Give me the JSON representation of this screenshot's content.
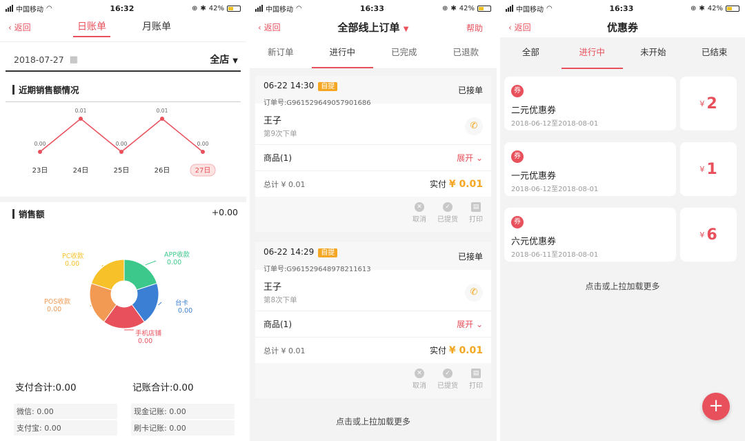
{
  "colors": {
    "accent": "#e8505b",
    "tag": "#f5a623",
    "pay": "#f5a623"
  },
  "statusbar": {
    "carrier": "中国移动",
    "battery": "42%"
  },
  "screen1": {
    "time": "16:32",
    "back": "返回",
    "tabs": [
      "日账单",
      "月账单"
    ],
    "active_tab": 0,
    "date": "2018-07-27",
    "store": "全店",
    "trend_title": "近期销售额情况",
    "trend": {
      "labels": [
        "23日",
        "24日",
        "25日",
        "26日",
        "27日"
      ],
      "values": [
        "0.00",
        "0.01",
        "0.00",
        "0.01",
        "0.00"
      ],
      "numeric": [
        0.0,
        0.01,
        0.0,
        0.01,
        0.0
      ]
    },
    "sales_title": "销售额",
    "sales_value": "+0.00",
    "donut": {
      "segments": [
        {
          "name": "APP收款",
          "value": "0.00",
          "color": "#3dc88b",
          "share": 0.2
        },
        {
          "name": "台卡",
          "value": "0.00",
          "color": "#3b7fd4",
          "share": 0.2
        },
        {
          "name": "手机店铺",
          "value": "0.00",
          "color": "#e8505b",
          "share": 0.2
        },
        {
          "name": "POS收款",
          "value": "0.00",
          "color": "#f29a54",
          "share": 0.2
        },
        {
          "name": "PC收款",
          "value": "0.00",
          "color": "#f7c12a",
          "share": 0.2
        }
      ]
    },
    "pay_total": "支付合计:0.00",
    "account_total": "记账合计:0.00",
    "boxes": [
      "微信: 0.00",
      "现金记账: 0.00",
      "支付宝: 0.00",
      "刷卡记账: 0.00"
    ]
  },
  "screen2": {
    "time": "16:33",
    "back": "返回",
    "title": "全部线上订单",
    "help": "帮助",
    "tabs": [
      "新订单",
      "进行中",
      "已完成",
      "已退款"
    ],
    "active_tab": 1,
    "orders": [
      {
        "datetime": "06-22 14:30",
        "tag": "自提",
        "order_no": "订单号:G961529649057901686",
        "status": "已接单",
        "name": "王子",
        "visits": "第9次下单",
        "goods": "商品(1)",
        "expand": "展开",
        "total": "总计 ¥ 0.01",
        "paid_label": "实付",
        "paid": "¥ 0.01",
        "actions": [
          "取消",
          "已提货",
          "打印"
        ]
      },
      {
        "datetime": "06-22 14:29",
        "tag": "自提",
        "order_no": "订单号:G961529648978211613",
        "status": "已接单",
        "name": "王子",
        "visits": "第8次下单",
        "goods": "商品(1)",
        "expand": "展开",
        "total": "总计 ¥ 0.01",
        "paid_label": "实付",
        "paid": "¥ 0.01",
        "actions": [
          "取消",
          "已提货",
          "打印"
        ]
      }
    ],
    "load_more": "点击或上拉加载更多"
  },
  "screen3": {
    "time": "16:33",
    "back": "返回",
    "title": "优惠券",
    "tabs": [
      "全部",
      "进行中",
      "未开始",
      "已结束"
    ],
    "active_tab": 1,
    "coupons": [
      {
        "name": "二元优惠券",
        "period": "2018-06-12至2018-08-01",
        "amount": "2",
        "currency": "¥"
      },
      {
        "name": "一元优惠券",
        "period": "2018-06-12至2018-08-01",
        "amount": "1",
        "currency": "¥"
      },
      {
        "name": "六元优惠券",
        "period": "2018-06-11至2018-08-01",
        "amount": "6",
        "currency": "¥"
      }
    ],
    "load_more": "点击或上拉加载更多",
    "fab": "+"
  }
}
